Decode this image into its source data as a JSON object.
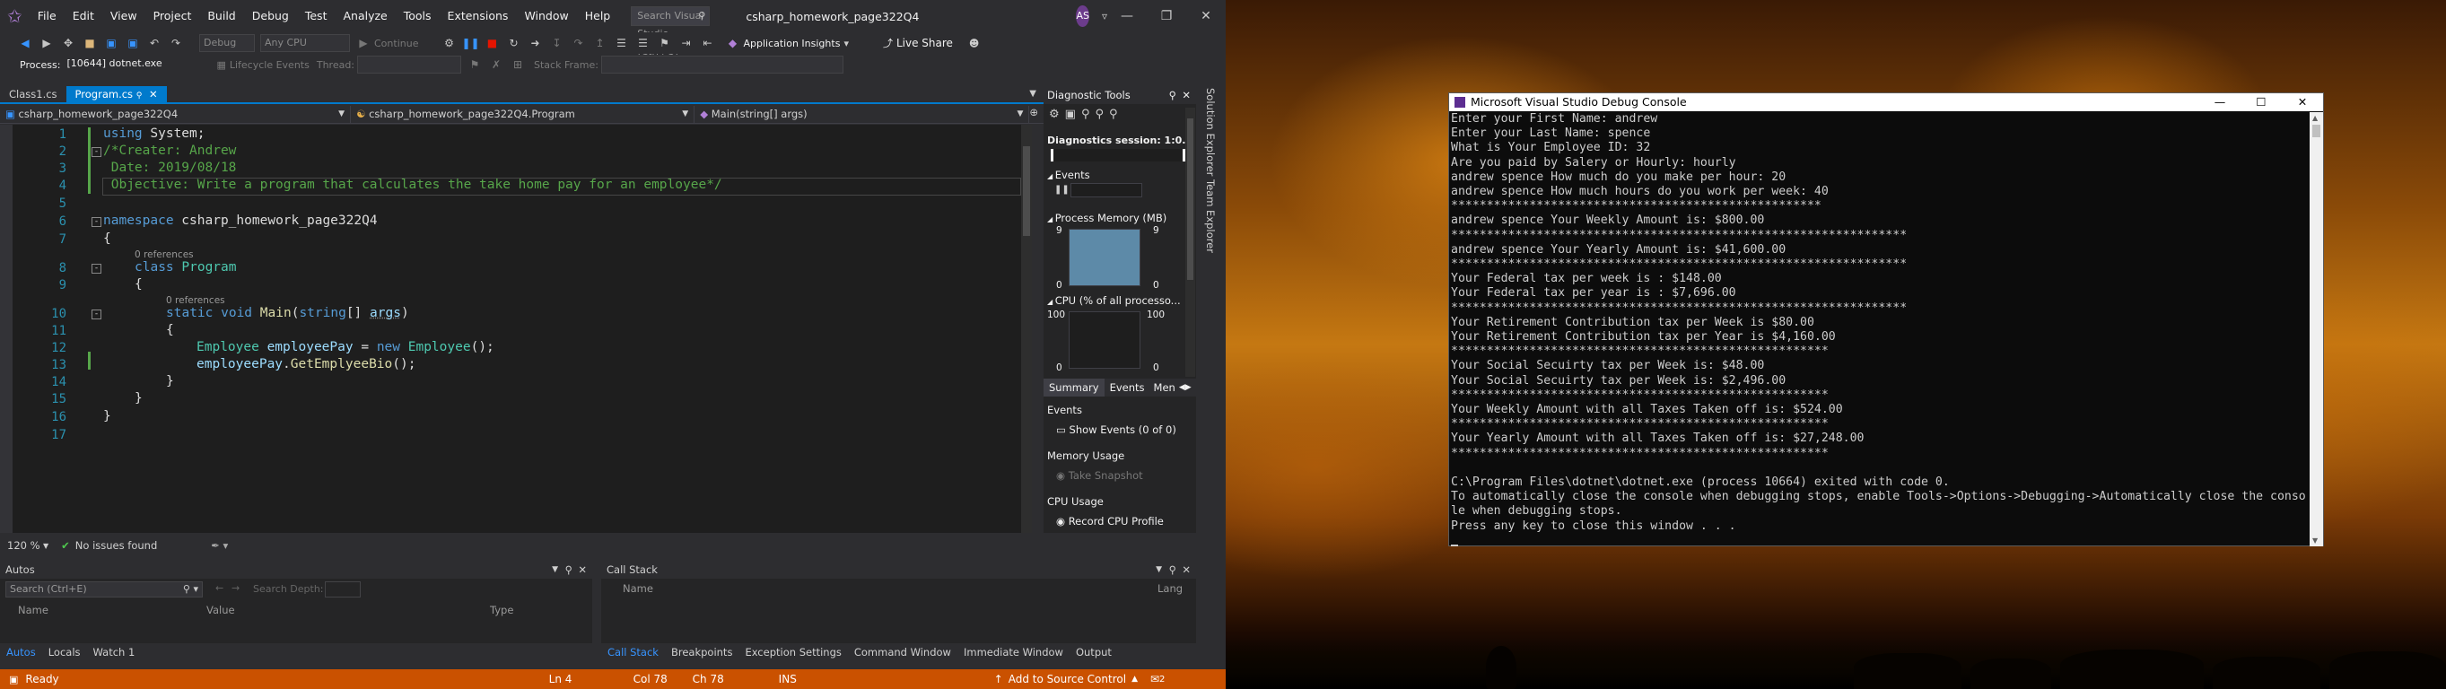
{
  "vs": {
    "menu": [
      "File",
      "Edit",
      "View",
      "Project",
      "Build",
      "Debug",
      "Test",
      "Analyze",
      "Tools",
      "Extensions",
      "Window",
      "Help"
    ],
    "search_placeholder": "Search Visual Studio (Ctrl+Q)",
    "solution_title": "csharp_homework_page322Q4",
    "avatar_initials": "AS",
    "toolbar": {
      "config": "Debug",
      "platform": "Any CPU",
      "continue": "Continue",
      "app_insights": "Application Insights",
      "live_share": "Live Share"
    },
    "process_bar": {
      "process_label": "Process:",
      "process_value": "[10644] dotnet.exe",
      "lifecycle": "Lifecycle Events",
      "thread_label": "Thread:",
      "stackframe_label": "Stack Frame:"
    },
    "doc_tabs": [
      {
        "label": "Class1.cs"
      },
      {
        "label": "Program.cs"
      }
    ],
    "nav": {
      "project": "csharp_homework_page322Q4",
      "class": "csharp_homework_page322Q4.Program",
      "member": "Main(string[] args)"
    },
    "code": {
      "line_numbers": [
        "1",
        "2",
        "3",
        "4",
        "5",
        "6",
        "7",
        "8",
        "9",
        "10",
        "11",
        "12",
        "13",
        "14",
        "15",
        "16",
        "17"
      ],
      "l1_kw": "using",
      "l1_rest": " System;",
      "l2": "/*Creater: Andrew",
      "l3": " Date: 2019/08/18",
      "l4": " Objective: Write a program that calculates the take home pay for an employee*/",
      "l6_kw": "namespace",
      "l6_rest": " csharp_homework_page322Q4",
      "l7": "{",
      "refs0": "0 references",
      "l8_kw": "class",
      "l8_ty": " Program",
      "l9": "{",
      "refs1": "0 references",
      "l10_kw1": "static",
      "l10_kw2": " void",
      "l10_fn": " Main",
      "l10_p1": "(",
      "l10_kw3": "string",
      "l10_p2": "[] ",
      "l10_arg": "args",
      "l10_p3": ")",
      "l11": "{",
      "l12_ty": "Employee",
      "l12_var": " employeePay",
      "l12_eq": " = ",
      "l12_kw": "new",
      "l12_ty2": " Employee",
      "l12_end": "();",
      "l13_var": "employeePay",
      "l13_dot": ".",
      "l13_fn": "GetEmplyeeBio",
      "l13_end": "();",
      "l14": "}",
      "l15": "}",
      "l16": "}"
    },
    "editor_status": {
      "zoom": "120 %",
      "issues": "No issues found"
    },
    "diagnostics": {
      "title": "Diagnostic Tools",
      "session": "Diagnostics session: 1:0...",
      "events": "Events",
      "process_memory": "Process Memory (MB)",
      "mem_max": "9",
      "mem_min": "0",
      "cpu": "CPU (% of all processo...",
      "cpu_max": "100",
      "cpu_min": "0",
      "tabs": [
        "Summary",
        "Events",
        "Men"
      ],
      "summary_events": "Events",
      "show_events": "Show Events (0 of 0)",
      "memory_usage": "Memory Usage",
      "take_snapshot": "Take Snapshot",
      "cpu_usage": "CPU Usage",
      "record_cpu": "Record CPU Profile"
    },
    "side_tabs": [
      "Solution Explorer",
      "Team Explorer"
    ],
    "autos": {
      "title": "Autos",
      "search": "Search (Ctrl+E)",
      "search_depth": "Search Depth:",
      "cols": [
        "Name",
        "Value",
        "Type"
      ],
      "tabs": [
        "Autos",
        "Locals",
        "Watch 1"
      ]
    },
    "callstack": {
      "title": "Call Stack",
      "cols": [
        "Name",
        "Lang"
      ],
      "tabs": [
        "Call Stack",
        "Breakpoints",
        "Exception Settings",
        "Command Window",
        "Immediate Window",
        "Output"
      ]
    },
    "status": {
      "ready": "Ready",
      "ln": "Ln 4",
      "col": "Col 78",
      "ch": "Ch 78",
      "ins": "INS",
      "source_control": "Add to Source Control",
      "notif": "2"
    }
  },
  "console": {
    "title": "Microsoft Visual Studio Debug Console",
    "lines": [
      "Enter your First Name: andrew",
      "Enter your Last Name: spence",
      "What is Your Employee ID: 32",
      "Are you paid by Salery or Hourly: hourly",
      "andrew spence How much do you make per hour: 20",
      "andrew spence How much hours do you work per week: 40",
      "****************************************************",
      "andrew spence Your Weekly Amount is: $800.00",
      "****************************************************************",
      "andrew spence Your Yearly Amount is: $41,600.00",
      "****************************************************************",
      "Your Federal tax per week is : $148.00",
      "Your Federal tax per year is : $7,696.00",
      "****************************************************************",
      "Your Retirement Contribution tax per Week is $80.00",
      "Your Retirement Contribution tax per Year is $4,160.00",
      "*****************************************************",
      "Your Social Secuirty tax per Week is: $48.00",
      "Your Social Secuirty tax per Week is: $2,496.00",
      "*****************************************************",
      "Your Weekly Amount with all Taxes Taken off is: $524.00",
      "*****************************************************",
      "Your Yearly Amount with all Taxes Taken off is: $27,248.00",
      "*****************************************************",
      "",
      "C:\\Program Files\\dotnet\\dotnet.exe (process 10664) exited with code 0.",
      "To automatically close the console when debugging stops, enable Tools->Options->Debugging->Automatically close the conso",
      "le when debugging stops.",
      "Press any key to close this window . . ."
    ]
  },
  "colors": {
    "accent": "#007acc",
    "statusbar": "#ca5100",
    "editor_bg": "#1e1e1e",
    "chrome": "#2d2d30"
  }
}
